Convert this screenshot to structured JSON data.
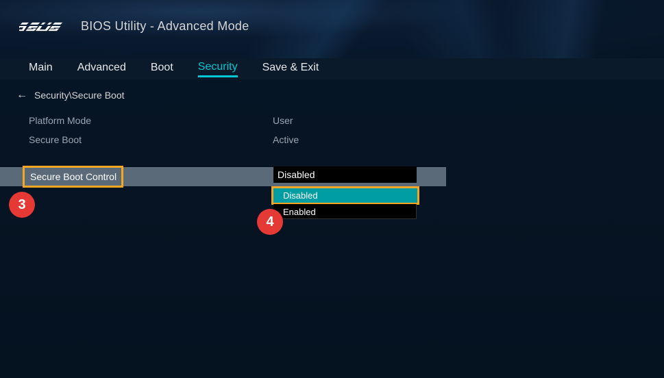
{
  "header": {
    "brand": "ASUS",
    "title": "BIOS Utility - Advanced Mode"
  },
  "nav": {
    "tabs": [
      {
        "label": "Main"
      },
      {
        "label": "Advanced"
      },
      {
        "label": "Boot"
      },
      {
        "label": "Security"
      },
      {
        "label": "Save & Exit"
      }
    ],
    "active_index": 3
  },
  "breadcrumb": {
    "path": "Security\\Secure Boot"
  },
  "settings": {
    "rows": [
      {
        "label": "Platform Mode",
        "value": "User"
      },
      {
        "label": "Secure Boot",
        "value": "Active"
      }
    ],
    "selected": {
      "label": "Secure Boot Control",
      "value": "Disabled"
    }
  },
  "dropdown": {
    "options": [
      {
        "label": "Disabled",
        "highlighted": true
      },
      {
        "label": "Enabled",
        "highlighted": false
      }
    ]
  },
  "annotations": {
    "badge3": "3",
    "badge4": "4"
  },
  "colors": {
    "accent": "#00c8d4",
    "highlight_border": "#f5a623",
    "dropdown_highlight": "#009da5",
    "badge": "#e53935"
  }
}
